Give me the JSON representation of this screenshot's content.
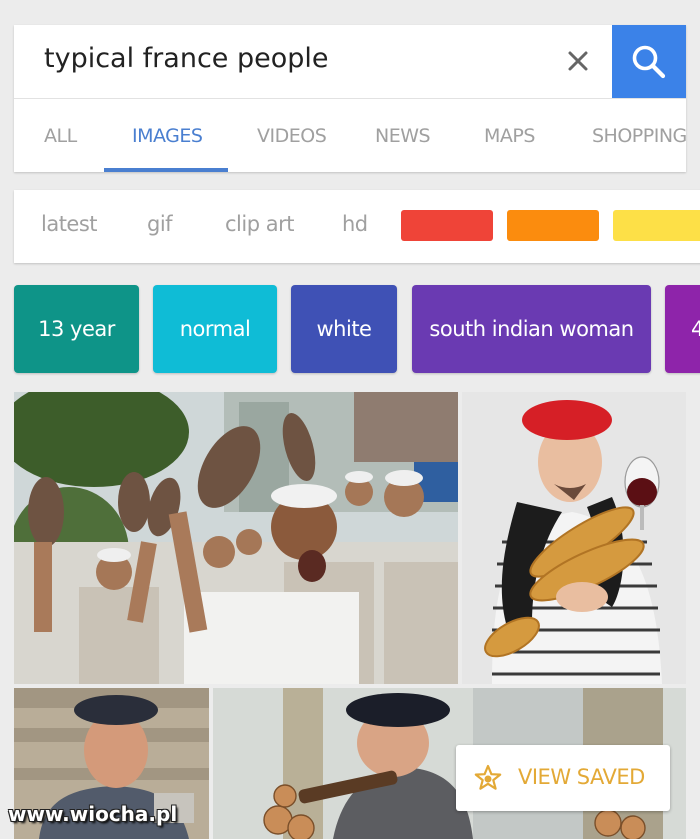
{
  "search": {
    "query": "typical france people"
  },
  "tabs": [
    {
      "label": "ALL"
    },
    {
      "label": "IMAGES"
    },
    {
      "label": "VIDEOS"
    },
    {
      "label": "NEWS"
    },
    {
      "label": "MAPS"
    },
    {
      "label": "SHOPPING"
    }
  ],
  "active_tab": "IMAGES",
  "filters": [
    {
      "label": "latest"
    },
    {
      "label": "gif"
    },
    {
      "label": "clip art"
    },
    {
      "label": "hd"
    }
  ],
  "color_filters": [
    "#ef4438",
    "#fb8c0e",
    "#fde047"
  ],
  "chips": [
    {
      "label": "13 year",
      "color": "#0e9488"
    },
    {
      "label": "normal",
      "color": "#0fbcd6"
    },
    {
      "label": "white",
      "color": "#3f51b5"
    },
    {
      "label": "south indian woman",
      "color": "#6a3ab2"
    },
    {
      "label": "4",
      "color": "#8e24aa"
    }
  ],
  "view_saved": {
    "label": "VIEW SAVED",
    "icon": "star-icon",
    "accent": "#e3a936"
  },
  "watermark": "www.wiocha.pl"
}
